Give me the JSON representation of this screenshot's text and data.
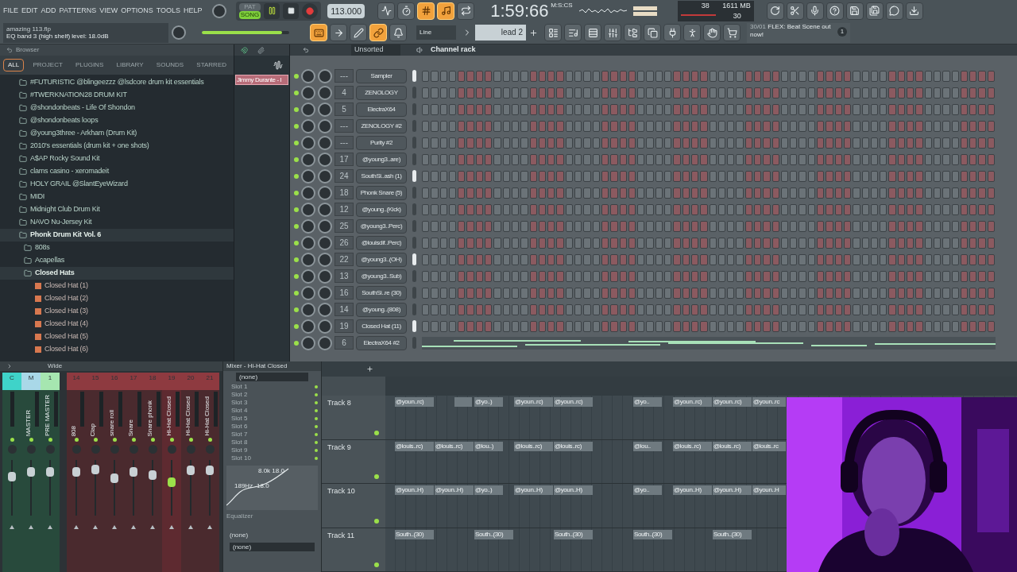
{
  "menu": [
    "FILE",
    "EDIT",
    "ADD",
    "PATTERNS",
    "VIEW",
    "OPTIONS",
    "TOOLS",
    "HELP"
  ],
  "transport": {
    "modes": [
      {
        "label": "PAT",
        "selected": false
      },
      {
        "label": "SONG",
        "selected": true
      }
    ],
    "playing": true,
    "tempo": "113.000"
  },
  "record_buttons": [
    {
      "on": false
    },
    {
      "on": false
    },
    {
      "on": true
    },
    {
      "on": true
    },
    {
      "on": false
    }
  ],
  "time": {
    "value": "1:59:66",
    "unit": "M:S:CS"
  },
  "monitor": {
    "cpu": "38",
    "memory": "1611 MB",
    "polyphony": "30"
  },
  "hint": {
    "file": "amazing 113.flp",
    "message": "EQ band 3 (high shelf) level: 18.0dB"
  },
  "master_volume": {
    "level": 0.92
  },
  "tool_buttons": [
    {
      "on": true
    },
    {
      "on": false
    },
    {
      "on": false
    },
    {
      "on": true
    },
    {
      "on": false
    }
  ],
  "snap": "Line",
  "pattern": "lead 2",
  "news": {
    "date": "30/01",
    "text": "FLEX: Beat Scene out now!",
    "badge": "1"
  },
  "browser": {
    "title": "Browser",
    "tabs": [
      {
        "label": "ALL",
        "selected": true
      },
      {
        "label": "PROJECT",
        "selected": false
      },
      {
        "label": "PLUGINS",
        "selected": false
      },
      {
        "label": "LIBRARY",
        "selected": false
      },
      {
        "label": "SOUNDS",
        "selected": false
      },
      {
        "label": "STARRED",
        "selected": false
      }
    ],
    "tree": [
      {
        "kind": "folder",
        "label": "#FUTURISTIC @blingeezzz  @lsdcore drum kit essentials",
        "expanded": false
      },
      {
        "kind": "folder",
        "label": "#TWERKNATION28 DRUM KIT",
        "expanded": false
      },
      {
        "kind": "folder",
        "label": "@shondonbeats - Life Of Shondon",
        "expanded": false
      },
      {
        "kind": "folder",
        "label": "@shondonbeats loops",
        "expanded": false
      },
      {
        "kind": "folder",
        "label": "@young3three - Arkham (Drum Kit)",
        "expanded": false
      },
      {
        "kind": "folder",
        "label": "2010's essentials (drum kit + one shots)",
        "expanded": false
      },
      {
        "kind": "folder",
        "label": "A$AP Rocky Sound Kit",
        "expanded": false
      },
      {
        "kind": "folder",
        "label": "clams casino - xeromadeit",
        "expanded": false
      },
      {
        "kind": "folder",
        "label": "HOLY GRAIL @SlantEyeWizard",
        "expanded": false
      },
      {
        "kind": "folder",
        "label": "MIDI",
        "expanded": false
      },
      {
        "kind": "folder",
        "label": "Midnight Club Drum Kit",
        "expanded": false
      },
      {
        "kind": "folder",
        "label": "NAVO Nu-Jersey Kit",
        "expanded": false
      },
      {
        "kind": "folder",
        "label": "Phonk Drum Kit Vol. 6",
        "expanded": true,
        "children": [
          {
            "kind": "folder",
            "label": "808s",
            "expanded": false
          },
          {
            "kind": "folder",
            "label": "Acapellas",
            "expanded": false
          },
          {
            "kind": "folder",
            "label": "Closed Hats",
            "expanded": true,
            "children": [
              {
                "kind": "file",
                "label": "Closed Hat (1)"
              },
              {
                "kind": "file",
                "label": "Closed Hat (2)"
              },
              {
                "kind": "file",
                "label": "Closed Hat (3)"
              },
              {
                "kind": "file",
                "label": "Closed Hat (4)"
              },
              {
                "kind": "file",
                "label": "Closed Hat (5)"
              },
              {
                "kind": "file",
                "label": "Closed Hat (6)"
              }
            ]
          }
        ]
      }
    ]
  },
  "picker": {
    "clip": "Jimmy Durante - I"
  },
  "channel_rack": {
    "filter": "Unsorted",
    "title": "Channel rack",
    "channels": [
      {
        "kind": "steps",
        "route": "---",
        "name": "Sampler",
        "selected": true
      },
      {
        "kind": "steps",
        "route": "4",
        "name": "ZENOLOGY",
        "selected": false
      },
      {
        "kind": "steps",
        "route": "5",
        "name": "ElectraX64",
        "selected": false
      },
      {
        "kind": "steps",
        "route": "---",
        "name": "ZENOLOGY #2",
        "selected": false
      },
      {
        "kind": "steps",
        "route": "---",
        "name": "Purity #2",
        "selected": false
      },
      {
        "kind": "steps",
        "route": "17",
        "name": "@young3..are)",
        "selected": false
      },
      {
        "kind": "steps",
        "route": "24",
        "name": "SouthSi..ash (1)",
        "selected": true
      },
      {
        "kind": "steps",
        "route": "18",
        "name": "Phonk Snare (5)",
        "selected": false
      },
      {
        "kind": "steps",
        "route": "12",
        "name": "@young..(Kick)",
        "selected": false
      },
      {
        "kind": "steps",
        "route": "25",
        "name": "@young3..Perc)",
        "selected": false
      },
      {
        "kind": "steps",
        "route": "26",
        "name": "@louisdif..Perc)",
        "selected": false
      },
      {
        "kind": "steps",
        "route": "22",
        "name": "@young3..(OH)",
        "selected": true
      },
      {
        "kind": "steps",
        "route": "13",
        "name": "@young3..Sub)",
        "selected": false
      },
      {
        "kind": "steps",
        "route": "16",
        "name": "SouthSi..re (30)",
        "selected": false
      },
      {
        "kind": "steps",
        "route": "14",
        "name": "@young..(808)",
        "selected": false
      },
      {
        "kind": "steps",
        "route": "19",
        "name": "Closed Hat (11)",
        "selected": true
      },
      {
        "kind": "notes",
        "route": "6",
        "name": "ElectraX64 #2",
        "selected": false
      }
    ]
  },
  "mixer": {
    "stereo": "Wide",
    "strips": [
      {
        "number": "C",
        "color": "#3fd3c9",
        "selected": false,
        "level": 0.75
      },
      {
        "number": "M",
        "name": "MASTER",
        "color": "#a9d8e8",
        "selected": false,
        "level": 0.85
      },
      {
        "number": "1",
        "name": "PRE MASTER",
        "color": "#a6e6b0",
        "selected": false,
        "level": 0.85
      },
      {
        "number": "14",
        "name": "808",
        "color": "#8e3a40",
        "selected": false,
        "level": 0.85
      },
      {
        "number": "15",
        "name": "Clap",
        "color": "#8e3a40",
        "selected": false,
        "level": 0.9
      },
      {
        "number": "16",
        "name": "snare roll",
        "color": "#8e3a40",
        "selected": false,
        "level": 0.7
      },
      {
        "number": "17",
        "name": "Snare",
        "color": "#8e3a40",
        "selected": false,
        "level": 0.85
      },
      {
        "number": "18",
        "name": "Snare phonk",
        "color": "#8e3a40",
        "selected": false,
        "level": 0.77
      },
      {
        "number": "19",
        "name": "Hi-Hat Closed",
        "color": "#8e3a40",
        "selected": true,
        "level": 0.62
      },
      {
        "number": "20",
        "name": "Hi-Hat Closed",
        "color": "#8e3a40",
        "selected": false,
        "level": 0.88
      },
      {
        "number": "21",
        "name": "Hi-Hat Closed",
        "color": "#8e3a40",
        "selected": false,
        "level": 0.88
      }
    ]
  },
  "insert": {
    "title": "Mixer - Hi-Hat Closed",
    "input": "(none)",
    "slots": [
      "Slot 1",
      "Slot 2",
      "Slot 3",
      "Slot 4",
      "Slot 5",
      "Slot 6",
      "Slot 7",
      "Slot 8",
      "Slot 9",
      "Slot 10"
    ],
    "eq_labels": [
      "8.0k 18.0",
      "189Hz -18.0"
    ],
    "plugin": "Equalizer",
    "output_1": "(none)",
    "output_2": "(none)"
  },
  "playlist": {
    "tracks": [
      {
        "name": "Track 8",
        "clips": [
          {
            "kind": "clip",
            "label": "@youn..rc)"
          },
          {
            "kind": "stub"
          },
          {
            "kind": "short",
            "label": "@yo..)"
          },
          {
            "kind": "clip",
            "label": "@youn..rc)"
          },
          {
            "kind": "clip",
            "label": "@youn..rc)"
          },
          {
            "kind": "gap"
          },
          {
            "kind": "short",
            "label": "@yo.."
          },
          {
            "kind": "clip",
            "label": "@youn..rc)"
          },
          {
            "kind": "clip",
            "label": "@youn..rc)"
          },
          {
            "kind": "cut",
            "label": "@youn..rc"
          }
        ]
      },
      {
        "name": "Track 9",
        "clips": [
          {
            "kind": "clip",
            "label": "@louis..rc)"
          },
          {
            "kind": "clip",
            "label": "@louis..rc)"
          },
          {
            "kind": "short",
            "label": "@lou..)"
          },
          {
            "kind": "clip",
            "label": "@louis..rc)"
          },
          {
            "kind": "clip",
            "label": "@louis..rc)"
          },
          {
            "kind": "gap"
          },
          {
            "kind": "short",
            "label": "@lou.."
          },
          {
            "kind": "clip",
            "label": "@louis..rc)"
          },
          {
            "kind": "clip",
            "label": "@louis..rc)"
          },
          {
            "kind": "cut",
            "label": "@louis..rc"
          }
        ]
      },
      {
        "name": "Track 10",
        "clips": [
          {
            "kind": "clip",
            "label": "@youn..H)"
          },
          {
            "kind": "clip",
            "label": "@youn..H)"
          },
          {
            "kind": "short",
            "label": "@yo..)"
          },
          {
            "kind": "clip",
            "label": "@youn..H)"
          },
          {
            "kind": "clip",
            "label": "@youn..H)"
          },
          {
            "kind": "gap"
          },
          {
            "kind": "short",
            "label": "@yo.."
          },
          {
            "kind": "clip",
            "label": "@youn..H)"
          },
          {
            "kind": "clip",
            "label": "@youn..H)"
          },
          {
            "kind": "cut",
            "label": "@youn..H"
          }
        ]
      },
      {
        "name": "Track 11",
        "clips": [
          {
            "kind": "clip",
            "label": "South..(30)"
          },
          {
            "kind": "gap"
          },
          {
            "kind": "clip",
            "label": "South..(30)"
          },
          {
            "kind": "gap"
          },
          {
            "kind": "clip",
            "label": "South..(30)"
          },
          {
            "kind": "gap"
          },
          {
            "kind": "clip",
            "label": "South..(30)"
          },
          {
            "kind": "gap"
          },
          {
            "kind": "clip",
            "label": "South..(30)"
          },
          {
            "kind": "gap"
          }
        ]
      }
    ]
  }
}
